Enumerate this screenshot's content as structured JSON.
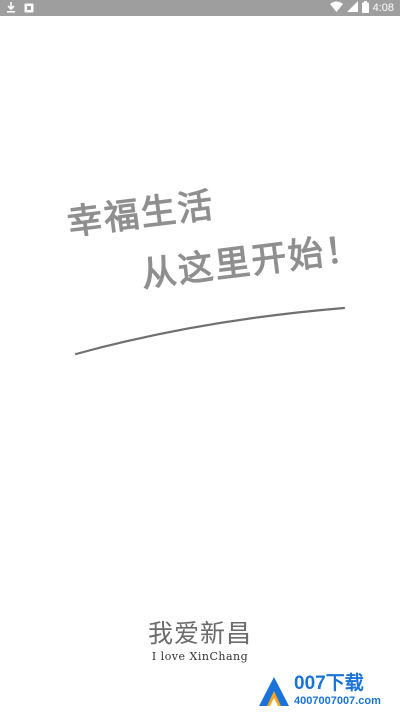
{
  "status_bar": {
    "time": "4:08",
    "left_icons": [
      "download-icon",
      "notification-icon"
    ],
    "right_icons": [
      "wifi-icon",
      "signal-icon",
      "battery-icon"
    ]
  },
  "splash": {
    "slogan_line1": "幸福生活",
    "slogan_line2": "从这里开始！",
    "text_color": "#8f8f8f"
  },
  "logo": {
    "chinese": "我爱新昌",
    "english": "I love XinChang"
  },
  "watermark": {
    "brand": "007下载",
    "phone": "4007007007.com",
    "color": "#1a73d9"
  }
}
